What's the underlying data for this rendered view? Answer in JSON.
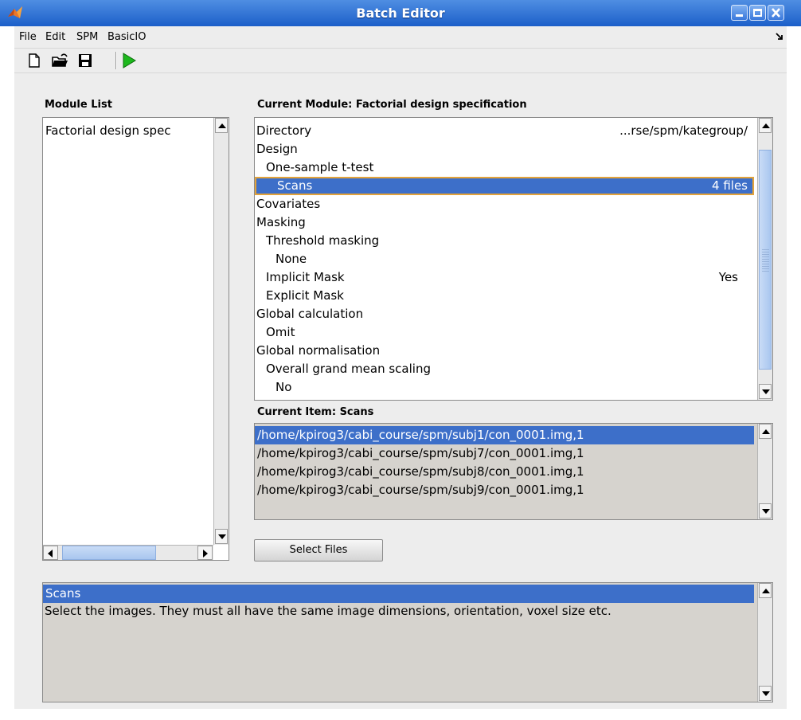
{
  "window": {
    "title": "Batch Editor"
  },
  "menu": {
    "file": "File",
    "edit": "Edit",
    "spm": "SPM",
    "basicio": "BasicIO"
  },
  "toolbar": {
    "new_icon": "new-file-icon",
    "open_icon": "open-folder-icon",
    "save_icon": "save-disk-icon",
    "run_icon": "run-play-icon",
    "run_color": "#1db81d"
  },
  "module_list": {
    "label": "Module List",
    "items": [
      "Factorial design spec"
    ]
  },
  "current_module": {
    "label": "Current Module: Factorial design specification",
    "rows": [
      {
        "text": "Directory",
        "value": "...rse/spm/kategroup/"
      },
      {
        "text": "Design",
        "value": ""
      },
      {
        "text": "One-sample t-test",
        "value": ""
      },
      {
        "text": "Scans",
        "value": "4 files"
      },
      {
        "text": "Covariates",
        "value": ""
      },
      {
        "text": "Masking",
        "value": ""
      },
      {
        "text": "Threshold masking",
        "value": ""
      },
      {
        "text": "None",
        "value": ""
      },
      {
        "text": "Implicit Mask",
        "value": "Yes"
      },
      {
        "text": "Explicit Mask",
        "value": ""
      },
      {
        "text": "Global calculation",
        "value": ""
      },
      {
        "text": "Omit",
        "value": ""
      },
      {
        "text": "Global normalisation",
        "value": ""
      },
      {
        "text": "Overall grand mean scaling",
        "value": ""
      },
      {
        "text": "No",
        "value": ""
      }
    ]
  },
  "current_item": {
    "label": "Current Item: Scans",
    "files": [
      "/home/kpirog3/cabi_course/spm/subj1/con_0001.img,1",
      "/home/kpirog3/cabi_course/spm/subj7/con_0001.img,1",
      "/home/kpirog3/cabi_course/spm/subj8/con_0001.img,1",
      "/home/kpirog3/cabi_course/spm/subj9/con_0001.img,1"
    ]
  },
  "buttons": {
    "select_files": "Select Files"
  },
  "help": {
    "title": "Scans",
    "text": "Select the images.  They must all have the same image dimensions, orientation, voxel size etc."
  },
  "colors": {
    "titlebar": "#2f72d6",
    "selection": "#3d6fc9",
    "selection_outline": "#e3a33a",
    "panel_grey": "#d6d3ce"
  }
}
